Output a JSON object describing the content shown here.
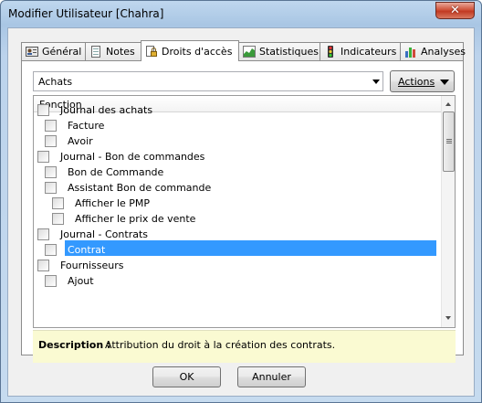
{
  "window": {
    "title": "Modifier Utilisateur [Chahra]",
    "close_glyph": "✕"
  },
  "tabs": [
    {
      "label": "Général",
      "icon": "id-card-icon"
    },
    {
      "label": "Notes",
      "icon": "notes-icon"
    },
    {
      "label": "Droits d'accès",
      "icon": "document-lock-icon",
      "active": true
    },
    {
      "label": "Statistiques",
      "icon": "area-chart-icon"
    },
    {
      "label": "Indicateurs",
      "icon": "traffic-light-icon"
    },
    {
      "label": "Analyses",
      "icon": "bar-chart-icon"
    }
  ],
  "module_select": {
    "value": "Achats"
  },
  "actions_button": {
    "label": "Actions"
  },
  "tree": {
    "column_header": "Fonction",
    "items": [
      {
        "label": "Journal des achats",
        "level": 0,
        "checked": false
      },
      {
        "label": "Facture",
        "level": 1,
        "checked": false
      },
      {
        "label": "Avoir",
        "level": 1,
        "checked": false
      },
      {
        "label": "Journal - Bon de commandes",
        "level": 0,
        "checked": false
      },
      {
        "label": "Bon de Commande",
        "level": 1,
        "checked": false
      },
      {
        "label": "Assistant Bon de commande",
        "level": 1,
        "checked": false
      },
      {
        "label": "Afficher le PMP",
        "level": 2,
        "checked": false
      },
      {
        "label": "Afficher le prix de vente",
        "level": 2,
        "checked": false
      },
      {
        "label": "Journal - Contrats",
        "level": 0,
        "checked": false
      },
      {
        "label": "Contrat",
        "level": 1,
        "checked": false,
        "selected": true
      },
      {
        "label": "Fournisseurs",
        "level": 0,
        "checked": false
      },
      {
        "label": "Ajout",
        "level": 1,
        "checked": false
      }
    ]
  },
  "description": {
    "label": "Description :",
    "text": "Attribution du droit à la création des contrats."
  },
  "footer": {
    "ok_label": "OK",
    "cancel_label": "Annuler"
  },
  "colors": {
    "selection": "#3399ff",
    "description_bg": "#fafad2",
    "close_button": "#c23a22"
  }
}
